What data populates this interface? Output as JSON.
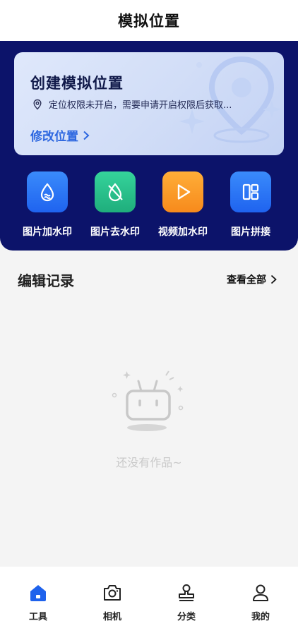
{
  "header": {
    "title": "模拟位置"
  },
  "card": {
    "title": "创建模拟位置",
    "notice": "定位权限未开启，需要申请开启权限后获取...",
    "link_label": "修改位置"
  },
  "tools": [
    {
      "label": "图片加水印",
      "icon": "image-watermark-icon",
      "color": "#2f7bf6"
    },
    {
      "label": "图片去水印",
      "icon": "remove-watermark-icon",
      "color": "#28c08d"
    },
    {
      "label": "视频加水印",
      "icon": "video-play-icon",
      "color": "#f99a25"
    },
    {
      "label": "图片拼接",
      "icon": "grid-layout-icon",
      "color": "#2f7bf6"
    }
  ],
  "records": {
    "title": "编辑记录",
    "more_label": "查看全部",
    "empty_text": "还没有作品~"
  },
  "nav": {
    "items": [
      {
        "label": "工具",
        "icon": "home-icon",
        "active": true
      },
      {
        "label": "相机",
        "icon": "camera-icon",
        "active": false
      },
      {
        "label": "分类",
        "icon": "stamp-icon",
        "active": false
      },
      {
        "label": "我的",
        "icon": "user-icon",
        "active": false
      }
    ]
  },
  "colors": {
    "panel": "#0c136a",
    "accent": "#2d67e0",
    "nav_active": "#1e62ec"
  }
}
